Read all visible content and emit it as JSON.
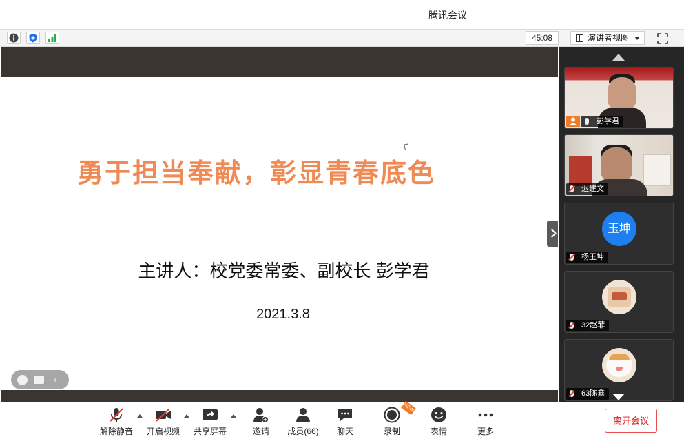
{
  "window": {
    "title": "腾讯会议"
  },
  "toolbar": {
    "icons": [
      "info-icon",
      "shield-icon",
      "signal-icon"
    ],
    "timer": "45:08",
    "view_mode": "演讲者视图",
    "fullscreen_icon": "fullscreen-icon"
  },
  "slide": {
    "title": "勇于担当奉献，彰显青春底色",
    "speaker": "主讲人：校党委常委、副校长 彭学君",
    "date": "2021.3.8",
    "title_color": "#ef8a55"
  },
  "participants": [
    {
      "name": "彭学君",
      "kind": "video",
      "host": true,
      "muted": false
    },
    {
      "name": "迟建文",
      "kind": "video",
      "host": false,
      "muted": true
    },
    {
      "name": "杨玉坤",
      "kind": "avatar-text",
      "avatar_text": "玉坤",
      "muted": true
    },
    {
      "name": "32赵菲",
      "kind": "avatar-image",
      "muted": true
    },
    {
      "name": "63陈鑫",
      "kind": "avatar-image",
      "muted": true
    }
  ],
  "controls": [
    {
      "label": "解除静音",
      "icon": "mic-muted-icon"
    },
    {
      "label": "开启视频",
      "icon": "video-off-icon"
    },
    {
      "label": "共享屏幕",
      "icon": "share-screen-icon"
    },
    {
      "label": "邀请",
      "icon": "invite-icon"
    },
    {
      "label": "成员(66)",
      "icon": "members-icon"
    },
    {
      "label": "聊天",
      "icon": "chat-icon"
    },
    {
      "label": "录制",
      "icon": "record-icon",
      "badge": "NEW"
    },
    {
      "label": "表情",
      "icon": "emoji-icon"
    },
    {
      "label": "更多",
      "icon": "more-icon"
    }
  ],
  "leave_button": "离开会议",
  "colors": {
    "accent_orange": "#f07b2a",
    "leave_red": "#e02020",
    "avatar_blue": "#1e80f0"
  }
}
